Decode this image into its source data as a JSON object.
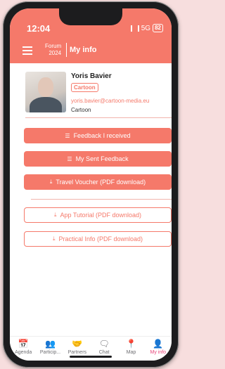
{
  "status": {
    "time": "12:04",
    "network": "5G",
    "battery": "82"
  },
  "header": {
    "brand_line1": "Forum",
    "brand_line2": "2024",
    "title": "My info"
  },
  "profile": {
    "name": "Yoris Bavier",
    "tag": "Cartoon",
    "email": "yoris.bavier@cartoon-media.eu",
    "company": "Cartoon"
  },
  "buttons": [
    {
      "label": "Feedback I received",
      "icon": "list-icon",
      "style": "filled"
    },
    {
      "label": "My Sent Feedback",
      "icon": "list-icon",
      "style": "filled"
    },
    {
      "label": "Travel Voucher (PDF download)",
      "icon": "download-icon",
      "style": "filled"
    },
    {
      "label": "App Tutorial (PDF download)",
      "icon": "download-icon",
      "style": "outline"
    },
    {
      "label": "Practical Info (PDF download)",
      "icon": "download-icon",
      "style": "outline"
    }
  ],
  "tabs": [
    {
      "label": "Agenda",
      "icon": "calendar-icon",
      "active": false
    },
    {
      "label": "Particip...",
      "icon": "people-icon",
      "active": false
    },
    {
      "label": "Partners",
      "icon": "handshake-icon",
      "active": false
    },
    {
      "label": "Chat",
      "icon": "chat-icon",
      "active": false
    },
    {
      "label": "Map",
      "icon": "map-pin-icon",
      "active": false
    },
    {
      "label": "My info",
      "icon": "person-icon",
      "active": true
    }
  ],
  "colors": {
    "accent": "#f5796a",
    "active_tab": "#e8457a"
  }
}
